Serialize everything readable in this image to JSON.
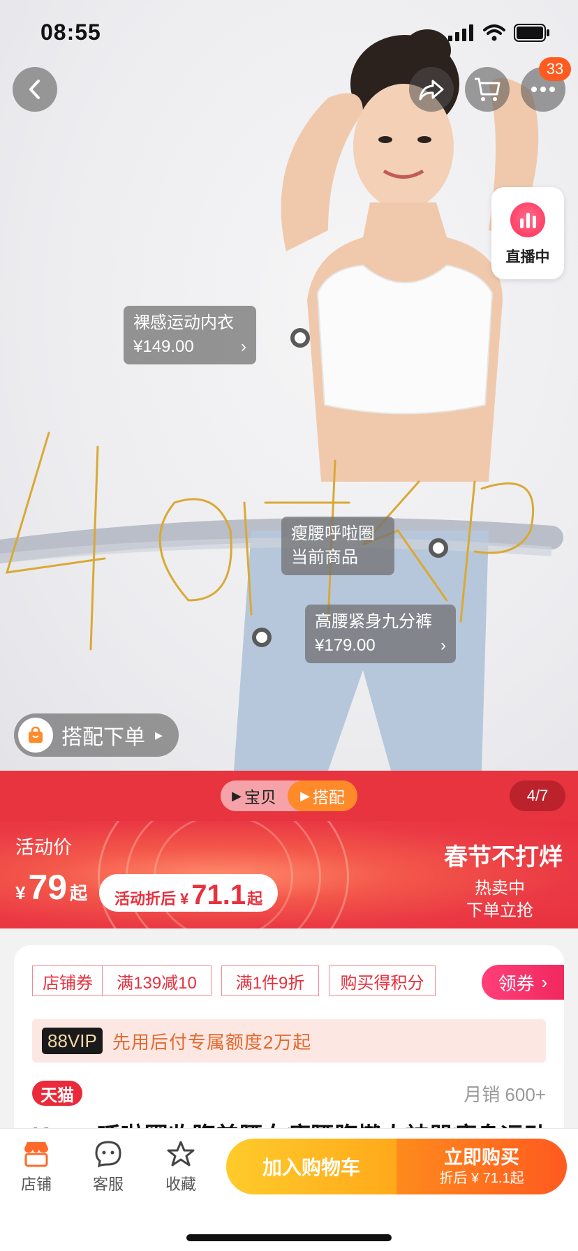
{
  "status_bar": {
    "time": "08:55"
  },
  "header": {
    "cart_badge": "33"
  },
  "live": {
    "label": "直播中"
  },
  "tags": [
    {
      "name": "裸感运动内衣",
      "price": "¥149.00"
    },
    {
      "name": "瘦腰呼啦圈",
      "sub": "当前商品"
    },
    {
      "name": "高腰紧身九分裤",
      "price": "¥179.00"
    }
  ],
  "combo_button": {
    "label": "搭配下单"
  },
  "tabs": {
    "items": [
      "宝贝",
      "搭配"
    ],
    "active": "搭配",
    "counter": "4/7"
  },
  "price": {
    "label": "活动价",
    "currency": "¥",
    "value": "79",
    "suffix": "起",
    "after_label": "活动折后",
    "after_currency": "¥",
    "after_value": "71.1",
    "after_suffix": "起"
  },
  "promo": {
    "title": "春节不打烊",
    "line1": "热卖中",
    "line2": "下单立抢"
  },
  "coupons": [
    "店铺券",
    "满139减10",
    "满1件9折",
    "购买得积分"
  ],
  "get_coupon": {
    "label": "领券"
  },
  "vip": {
    "badge": "88VIP",
    "text": "先用后付专属额度2万起"
  },
  "product": {
    "brand_badge": "天猫",
    "monthly_sales": "月销 600+",
    "title_peek": "Keep 呼啦圈收腹美腰女瘦腰腹懒人神器瘦身运动燃"
  },
  "bottom_nav": [
    {
      "label": "店铺",
      "icon": "shop-icon"
    },
    {
      "label": "客服",
      "icon": "service-icon"
    },
    {
      "label": "收藏",
      "icon": "star-icon"
    }
  ],
  "actions": {
    "add_cart": "加入购物车",
    "buy_now": "立即购买",
    "buy_sub": "折后 ¥ 71.1起"
  },
  "colors": {
    "brand_red": "#e8343f",
    "orange": "#ff5a1f",
    "yellow": "#ffc02a",
    "pink": "#f0295e"
  }
}
